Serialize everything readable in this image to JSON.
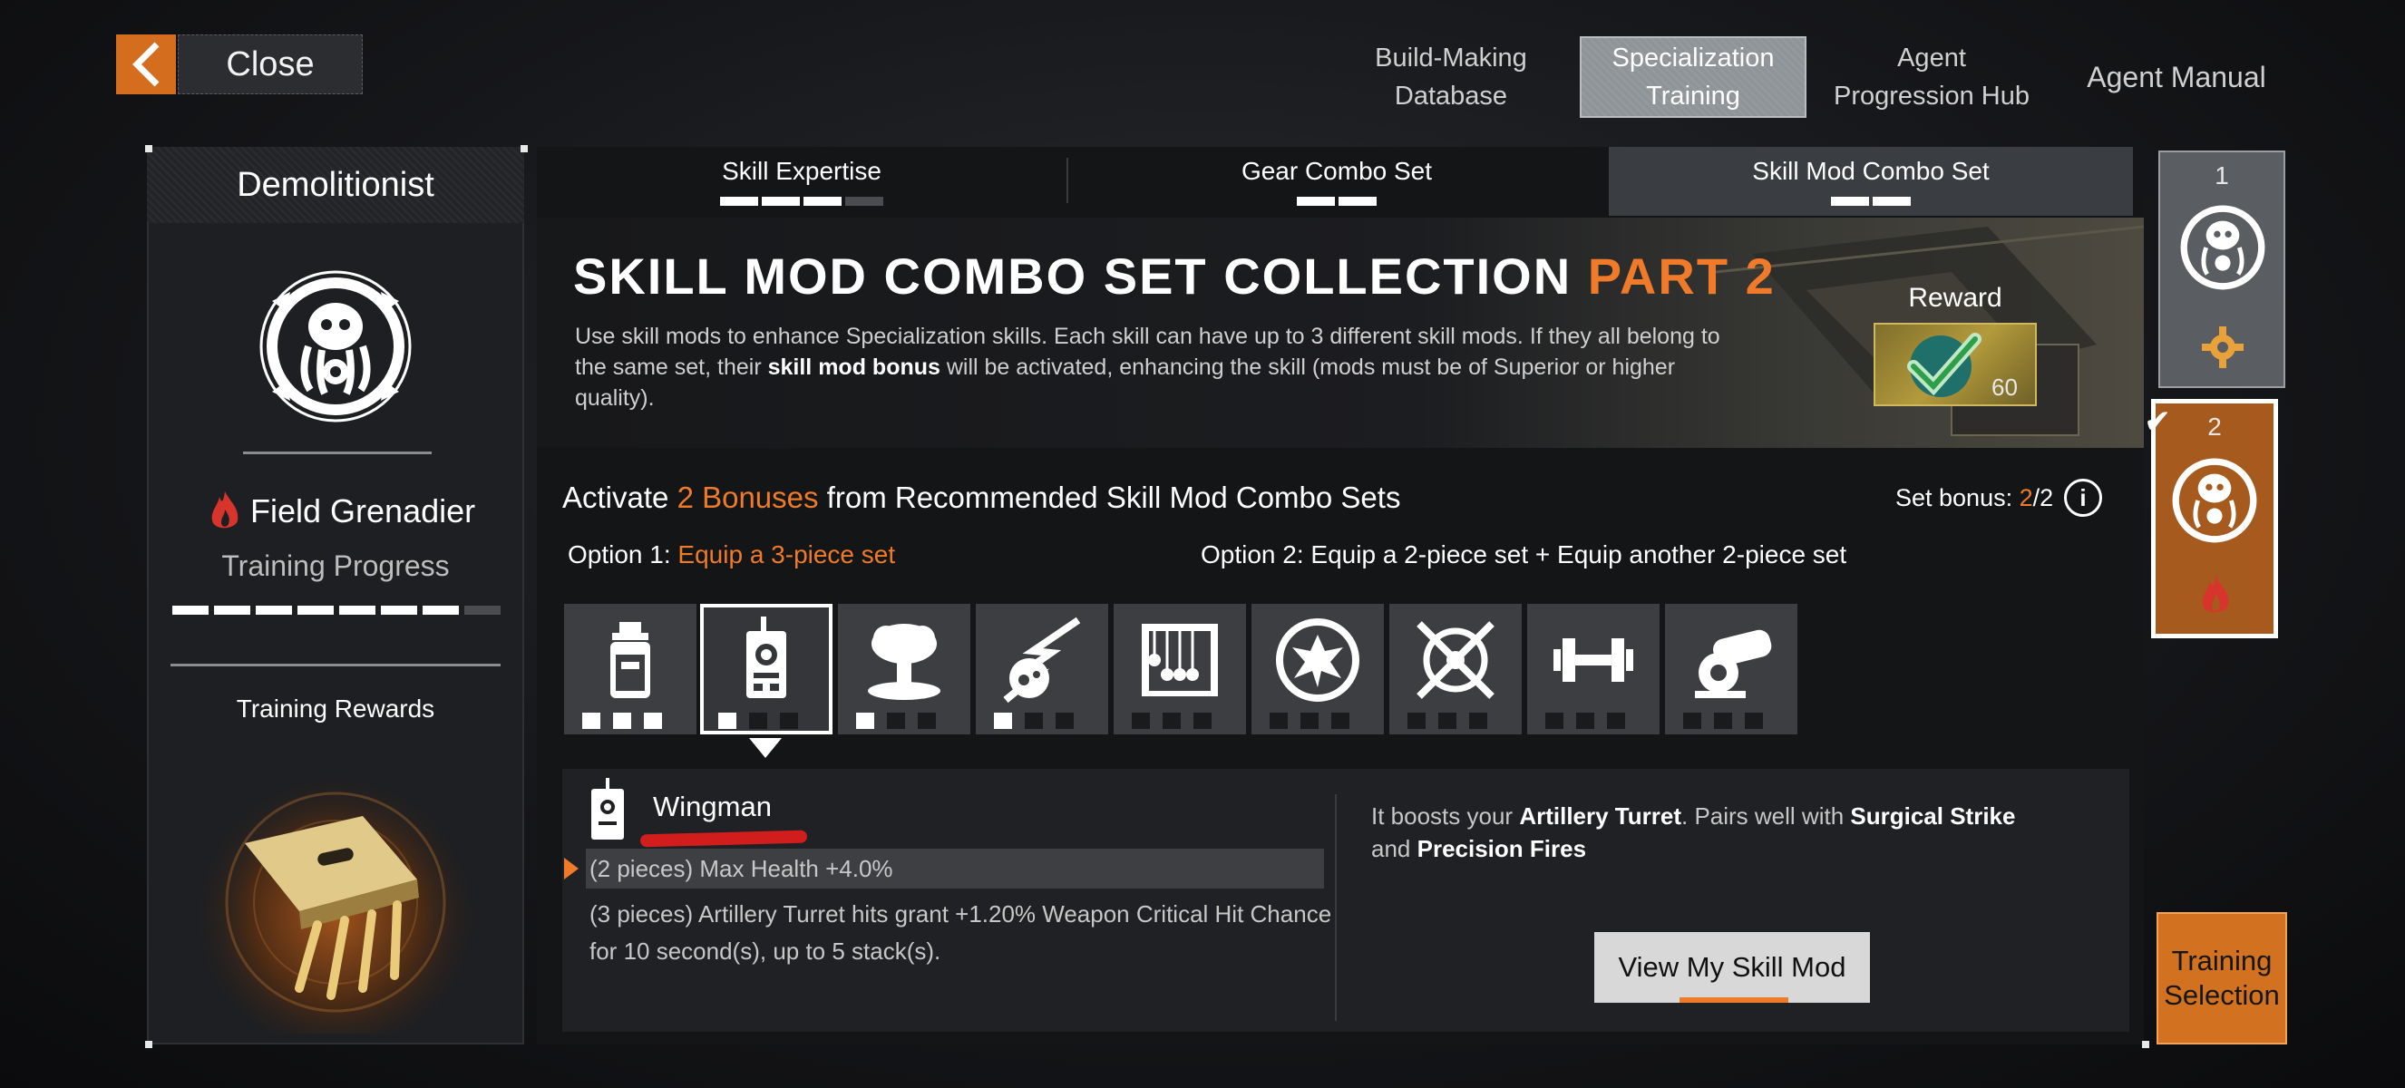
{
  "topbar": {
    "close_label": "Close",
    "tabs": [
      {
        "label_line1": "Build-Making",
        "label_line2": "Database",
        "active": false
      },
      {
        "label_line1": "Specialization",
        "label_line2": "Training",
        "active": true
      },
      {
        "label_line1": "Agent",
        "label_line2": "Progression Hub",
        "active": false
      },
      {
        "label_line1": "Agent Manual",
        "label_line2": "",
        "active": false
      }
    ]
  },
  "left": {
    "specialization": "Demolitionist",
    "skill_name": "Field Grenadier",
    "training_progress_label": "Training Progress",
    "training_progress": {
      "filled": 7,
      "total": 8
    },
    "training_rewards_label": "Training Rewards"
  },
  "subtabs": [
    {
      "label": "Skill Expertise",
      "pips_filled": 3,
      "pips_total": 4
    },
    {
      "label": "Gear Combo Set",
      "pips_filled": 2,
      "pips_total": 2
    },
    {
      "label": "Skill Mod Combo Set",
      "pips_filled": 2,
      "pips_total": 2,
      "active": true
    }
  ],
  "banner": {
    "title_main": "SKILL MOD COMBO SET COLLECTION",
    "title_highlight": "PART 2",
    "desc_1": "Use skill mods to enhance Specialization skills. Each skill can have up to 3 different skill mods. If they all belong to the same set, their ",
    "desc_bold": "skill mod bonus",
    "desc_2": " will be activated, enhancing the skill (mods must be of Superior or higher quality).",
    "reward_label": "Reward",
    "reward_amount": "60"
  },
  "objective": {
    "prefix": "Activate",
    "count": "2",
    "bonuses_word": "Bonuses",
    "suffix": "from Recommended Skill Mod Combo Sets",
    "set_bonus_label": "Set bonus:",
    "set_bonus_current": "2",
    "set_bonus_total": "/2",
    "option1_label": "Option 1:",
    "option1_value": "Equip a 3-piece set",
    "option2_label": "Option 2:",
    "option2_value": "Equip a 2-piece set + Equip another 2-piece set"
  },
  "mods": [
    {
      "icon": "bottle-icon",
      "filled": 3
    },
    {
      "icon": "radio-drone-icon",
      "filled": 1,
      "selected": true
    },
    {
      "icon": "mushroom-cloud-icon",
      "filled": 1
    },
    {
      "icon": "meteor-icon",
      "filled": 1
    },
    {
      "icon": "newtons-cradle-icon",
      "filled": 0
    },
    {
      "icon": "explosion-badge-icon",
      "filled": 0
    },
    {
      "icon": "crossed-target-icon",
      "filled": 0
    },
    {
      "icon": "dumbbell-icon",
      "filled": 0
    },
    {
      "icon": "cannon-icon",
      "filled": 0
    }
  ],
  "detail": {
    "mod_name": "Wingman",
    "bonus_2": "(2 pieces) Max Health +4.0%",
    "bonus_3": "(3 pieces) Artillery Turret hits grant +1.20% Weapon Critical Hit Chance for 10 second(s), up to 5 stack(s).",
    "right_1": "It boosts your ",
    "right_b1": "Artillery Turret",
    "right_2": ". Pairs well with ",
    "right_b2": "Surgical Strike",
    "right_3": " and ",
    "right_b3": "Precision Fires",
    "view_button": "View My Skill Mod"
  },
  "right": {
    "card1_num": "1",
    "card2_num": "2",
    "training_selection": "Training Selection"
  },
  "colors": {
    "accent": "#ee7a2a",
    "active_card": "#a65a1d",
    "annotation": "#d21d1d"
  }
}
